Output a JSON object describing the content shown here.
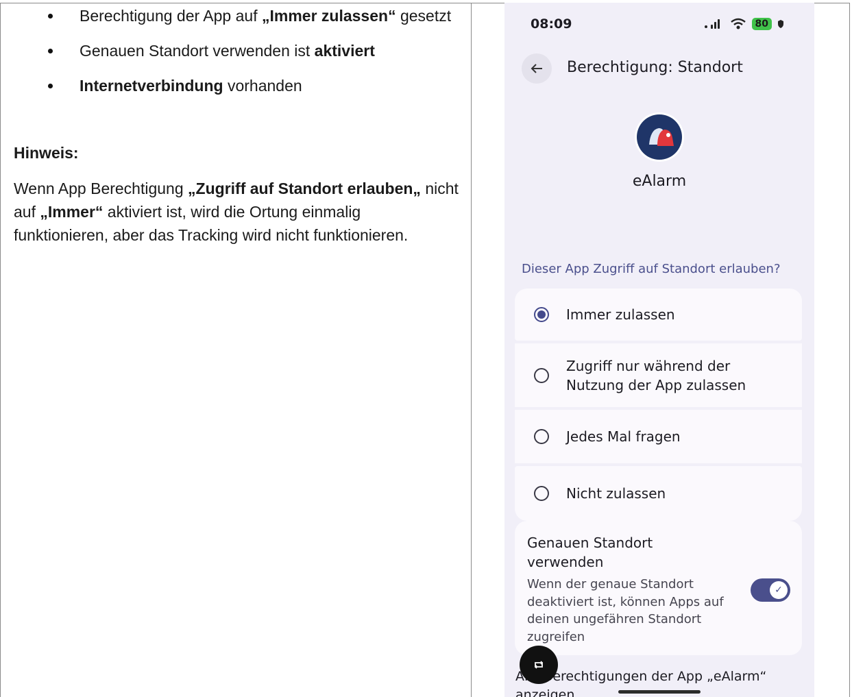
{
  "document": {
    "bullets": [
      {
        "parts": [
          {
            "text": "Berechtigung der App auf ",
            "bold": false
          },
          {
            "text": "„Immer zulassen“",
            "bold": true
          },
          {
            "text": " gesetzt",
            "bold": false
          }
        ]
      },
      {
        "parts": [
          {
            "text": "Genauen Standort verwenden ist ",
            "bold": false
          },
          {
            "text": "aktiviert",
            "bold": true
          }
        ]
      },
      {
        "parts": [
          {
            "text": "Internetverbindung",
            "bold": true
          },
          {
            "text": " vorhanden",
            "bold": false
          }
        ]
      }
    ],
    "hinweis_title": "Hinweis:",
    "hinweis_parts": [
      {
        "text": "Wenn App Berechtigung ",
        "bold": false
      },
      {
        "text": "„Zugriff auf Standort erlauben„",
        "bold": true
      },
      {
        "text": " nicht auf ",
        "bold": false
      },
      {
        "text": "„Immer“",
        "bold": true
      },
      {
        "text": "  aktiviert ist, wird die Ortung einmalig funktionieren, aber das Tracking wird nicht funktionieren.",
        "bold": false
      }
    ]
  },
  "phone": {
    "status": {
      "time": "08:09",
      "battery": "80"
    },
    "header_title": "Berechtigung: Standort",
    "app_name": "eAlarm",
    "question": "Dieser App Zugriff auf Standort erlauben?",
    "options": [
      {
        "label": "Immer zulassen",
        "selected": true
      },
      {
        "label": "Zugriff nur während der Nutzung der App zulassen",
        "selected": false
      },
      {
        "label": "Jedes Mal fragen",
        "selected": false
      },
      {
        "label": "Nicht zulassen",
        "selected": false
      }
    ],
    "precise": {
      "title": "Genauen Standort verwenden",
      "description": "Wenn der genaue Standort deaktiviert ist, können Apps auf deinen ungefähren Standort zugreifen",
      "enabled": true
    },
    "all_permissions": "Alle Berechtigungen der App „eAlarm“ anzeigen"
  },
  "colors": {
    "accent": "#4a4f8c",
    "background": "#f1eff8",
    "card": "#fbf9fd",
    "battery": "#40c24a"
  }
}
